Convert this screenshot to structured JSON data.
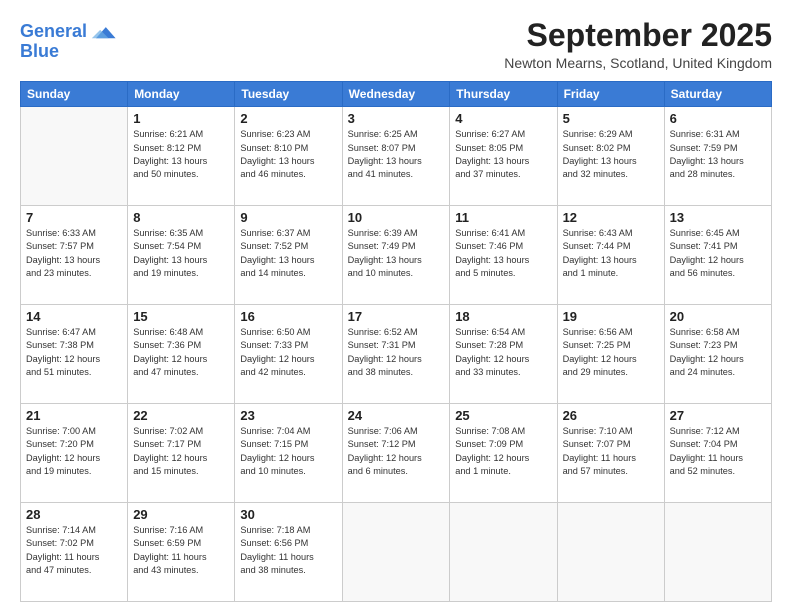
{
  "header": {
    "logo_line1": "General",
    "logo_line2": "Blue",
    "month_title": "September 2025",
    "subtitle": "Newton Mearns, Scotland, United Kingdom"
  },
  "weekdays": [
    "Sunday",
    "Monday",
    "Tuesday",
    "Wednesday",
    "Thursday",
    "Friday",
    "Saturday"
  ],
  "weeks": [
    [
      {
        "day": "",
        "info": ""
      },
      {
        "day": "1",
        "info": "Sunrise: 6:21 AM\nSunset: 8:12 PM\nDaylight: 13 hours\nand 50 minutes."
      },
      {
        "day": "2",
        "info": "Sunrise: 6:23 AM\nSunset: 8:10 PM\nDaylight: 13 hours\nand 46 minutes."
      },
      {
        "day": "3",
        "info": "Sunrise: 6:25 AM\nSunset: 8:07 PM\nDaylight: 13 hours\nand 41 minutes."
      },
      {
        "day": "4",
        "info": "Sunrise: 6:27 AM\nSunset: 8:05 PM\nDaylight: 13 hours\nand 37 minutes."
      },
      {
        "day": "5",
        "info": "Sunrise: 6:29 AM\nSunset: 8:02 PM\nDaylight: 13 hours\nand 32 minutes."
      },
      {
        "day": "6",
        "info": "Sunrise: 6:31 AM\nSunset: 7:59 PM\nDaylight: 13 hours\nand 28 minutes."
      }
    ],
    [
      {
        "day": "7",
        "info": "Sunrise: 6:33 AM\nSunset: 7:57 PM\nDaylight: 13 hours\nand 23 minutes."
      },
      {
        "day": "8",
        "info": "Sunrise: 6:35 AM\nSunset: 7:54 PM\nDaylight: 13 hours\nand 19 minutes."
      },
      {
        "day": "9",
        "info": "Sunrise: 6:37 AM\nSunset: 7:52 PM\nDaylight: 13 hours\nand 14 minutes."
      },
      {
        "day": "10",
        "info": "Sunrise: 6:39 AM\nSunset: 7:49 PM\nDaylight: 13 hours\nand 10 minutes."
      },
      {
        "day": "11",
        "info": "Sunrise: 6:41 AM\nSunset: 7:46 PM\nDaylight: 13 hours\nand 5 minutes."
      },
      {
        "day": "12",
        "info": "Sunrise: 6:43 AM\nSunset: 7:44 PM\nDaylight: 13 hours\nand 1 minute."
      },
      {
        "day": "13",
        "info": "Sunrise: 6:45 AM\nSunset: 7:41 PM\nDaylight: 12 hours\nand 56 minutes."
      }
    ],
    [
      {
        "day": "14",
        "info": "Sunrise: 6:47 AM\nSunset: 7:38 PM\nDaylight: 12 hours\nand 51 minutes."
      },
      {
        "day": "15",
        "info": "Sunrise: 6:48 AM\nSunset: 7:36 PM\nDaylight: 12 hours\nand 47 minutes."
      },
      {
        "day": "16",
        "info": "Sunrise: 6:50 AM\nSunset: 7:33 PM\nDaylight: 12 hours\nand 42 minutes."
      },
      {
        "day": "17",
        "info": "Sunrise: 6:52 AM\nSunset: 7:31 PM\nDaylight: 12 hours\nand 38 minutes."
      },
      {
        "day": "18",
        "info": "Sunrise: 6:54 AM\nSunset: 7:28 PM\nDaylight: 12 hours\nand 33 minutes."
      },
      {
        "day": "19",
        "info": "Sunrise: 6:56 AM\nSunset: 7:25 PM\nDaylight: 12 hours\nand 29 minutes."
      },
      {
        "day": "20",
        "info": "Sunrise: 6:58 AM\nSunset: 7:23 PM\nDaylight: 12 hours\nand 24 minutes."
      }
    ],
    [
      {
        "day": "21",
        "info": "Sunrise: 7:00 AM\nSunset: 7:20 PM\nDaylight: 12 hours\nand 19 minutes."
      },
      {
        "day": "22",
        "info": "Sunrise: 7:02 AM\nSunset: 7:17 PM\nDaylight: 12 hours\nand 15 minutes."
      },
      {
        "day": "23",
        "info": "Sunrise: 7:04 AM\nSunset: 7:15 PM\nDaylight: 12 hours\nand 10 minutes."
      },
      {
        "day": "24",
        "info": "Sunrise: 7:06 AM\nSunset: 7:12 PM\nDaylight: 12 hours\nand 6 minutes."
      },
      {
        "day": "25",
        "info": "Sunrise: 7:08 AM\nSunset: 7:09 PM\nDaylight: 12 hours\nand 1 minute."
      },
      {
        "day": "26",
        "info": "Sunrise: 7:10 AM\nSunset: 7:07 PM\nDaylight: 11 hours\nand 57 minutes."
      },
      {
        "day": "27",
        "info": "Sunrise: 7:12 AM\nSunset: 7:04 PM\nDaylight: 11 hours\nand 52 minutes."
      }
    ],
    [
      {
        "day": "28",
        "info": "Sunrise: 7:14 AM\nSunset: 7:02 PM\nDaylight: 11 hours\nand 47 minutes."
      },
      {
        "day": "29",
        "info": "Sunrise: 7:16 AM\nSunset: 6:59 PM\nDaylight: 11 hours\nand 43 minutes."
      },
      {
        "day": "30",
        "info": "Sunrise: 7:18 AM\nSunset: 6:56 PM\nDaylight: 11 hours\nand 38 minutes."
      },
      {
        "day": "",
        "info": ""
      },
      {
        "day": "",
        "info": ""
      },
      {
        "day": "",
        "info": ""
      },
      {
        "day": "",
        "info": ""
      }
    ]
  ]
}
